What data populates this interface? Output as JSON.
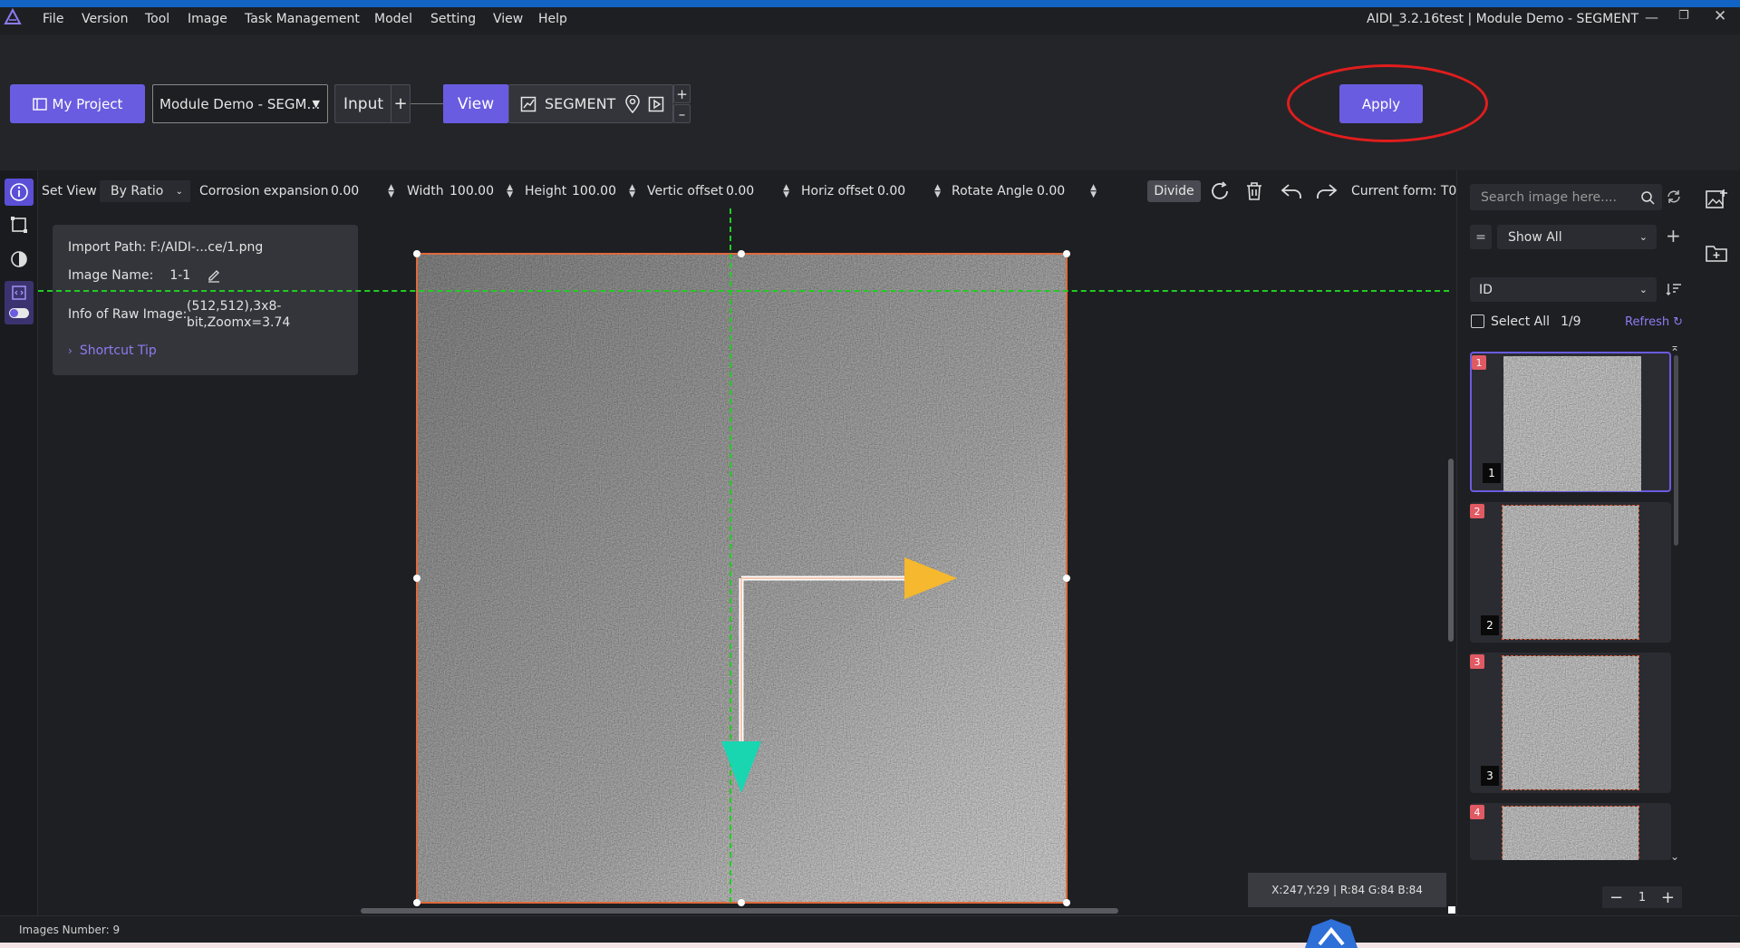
{
  "app": {
    "title": "AIDI_3.2.16test | Module Demo - SEGMENT"
  },
  "menu": [
    "File",
    "Version",
    "Tool",
    "Image",
    "Task Management",
    "Model",
    "Setting",
    "View",
    "Help"
  ],
  "toolbar": {
    "my_project": "My Project",
    "project_select": "Module Demo - SEGM…",
    "input_label": "Input",
    "add": "+",
    "view_label": "View",
    "segment_label": "SEGMENT",
    "apply": "Apply"
  },
  "controls": {
    "set_view": "Set View",
    "mode": "By Ratio",
    "corrosion_label": "Corrosion expansion",
    "corrosion_value": "0.00",
    "width_label": "Width",
    "width_value": "100.00",
    "height_label": "Height",
    "height_value": "100.00",
    "vertic_label": "Vertic offset",
    "vertic_value": "0.00",
    "horiz_label": "Horiz offset",
    "horiz_value": "0.00",
    "rotate_label": "Rotate Angle",
    "rotate_value": "0.00",
    "divide": "Divide",
    "current_form": "Current form: T0"
  },
  "info": {
    "import_path_label": "Import Path:",
    "import_path": "F:/AIDI-...ce/1.png",
    "image_name_label": "Image Name:",
    "image_name": "1-1",
    "raw_label": "Info of Raw Image:",
    "raw_line1": "(512,512),3x8-",
    "raw_line2": "bit,Zoomx=3.74",
    "shortcut": "Shortcut Tip"
  },
  "coords_readout": "X:247,Y:29 | R:84 G:84 B:84",
  "right": {
    "search_placeholder": "Search image here....",
    "filter": "Show All",
    "sort": "ID",
    "select_all": "Select All",
    "count": "1/9",
    "refresh": "Refresh",
    "thumbnails": [
      {
        "badge": "1",
        "label": "1"
      },
      {
        "badge": "2",
        "label": "2"
      },
      {
        "badge": "3",
        "label": "3"
      },
      {
        "badge": "4",
        "label": ""
      }
    ],
    "page": "1"
  },
  "status": {
    "images_number": "Images Number: 9"
  },
  "colors": {
    "accent": "#6a5ce0",
    "frame": "#e06a3c",
    "guide": "#22cc22",
    "arrow_x": "#f5b82e",
    "arrow_y": "#19d6b0",
    "annotation": "#e11d1d"
  }
}
